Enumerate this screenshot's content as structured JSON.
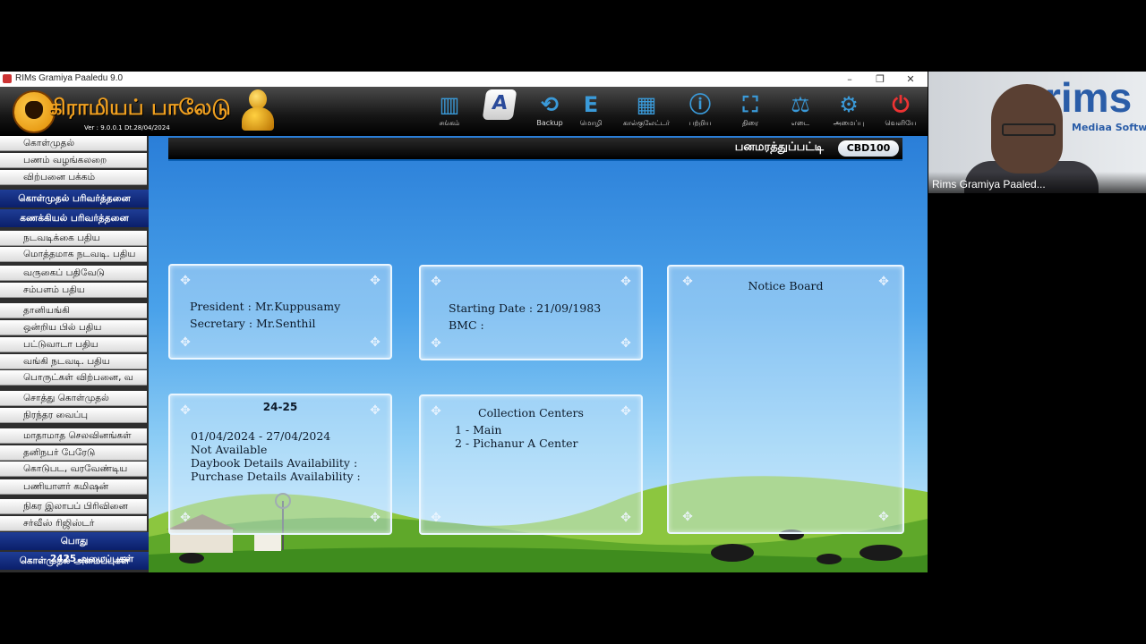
{
  "window": {
    "title": "RIMs Gramiya Paaledu 9.0",
    "minimize": "–",
    "restore": "❐",
    "close": "✕"
  },
  "header": {
    "logo_text": "கிராமியப் பாலேடு",
    "version": "Ver : 9.0.0.1     Dt.28/04/2024",
    "toolbar": [
      {
        "label": "சங்கம்",
        "icon": "building-icon",
        "glyph": "▥"
      },
      {
        "label": "",
        "icon": "keyboard-a-icon",
        "glyph": "A"
      },
      {
        "label": "Backup",
        "icon": "backup-icon",
        "glyph": "⟲"
      },
      {
        "label": "மொழி",
        "icon": "language-icon",
        "glyph": "E"
      },
      {
        "label": "கால்குலேட்டர்",
        "icon": "calculator-icon",
        "glyph": "▦"
      },
      {
        "label": "பற்றிய",
        "icon": "info-icon",
        "glyph": "ⓘ"
      },
      {
        "label": "திரை",
        "icon": "screen-icon",
        "glyph": "⛶"
      },
      {
        "label": "எடை",
        "icon": "weight-icon",
        "glyph": "⚖"
      },
      {
        "label": "அமைப்பு",
        "icon": "settings-icon",
        "glyph": "⚙"
      },
      {
        "label": "வெளியே",
        "icon": "power-icon",
        "glyph": "⏻"
      }
    ]
  },
  "sidebar": {
    "items": [
      {
        "label": "கொள்முதல்",
        "type": "item"
      },
      {
        "label": "பணம் வழங்கலறை",
        "type": "item"
      },
      {
        "label": "விற்பனை பக்கம்",
        "type": "item"
      },
      {
        "label": "கொள்முதல் பரிவர்த்தனை",
        "type": "head"
      },
      {
        "label": "கணக்கியல் பரிவர்த்தனை",
        "type": "head"
      },
      {
        "label": "நடவடிக்கை பதிய",
        "type": "item"
      },
      {
        "label": "மொத்தமாக நடவடி. பதிய",
        "type": "item"
      },
      {
        "label": "வருகைப் பதிவேடு",
        "type": "item"
      },
      {
        "label": "சம்பளம் பதிய",
        "type": "item"
      },
      {
        "label": "தானியங்கி",
        "type": "item"
      },
      {
        "label": "ஒன்றிய பில் பதிய",
        "type": "item"
      },
      {
        "label": "பட்டுவாடா பதிய",
        "type": "item"
      },
      {
        "label": "வங்கி நடவடி. பதிய",
        "type": "item"
      },
      {
        "label": "பொருட்கள் விற்பனை, வ",
        "type": "item"
      },
      {
        "label": "சொத்து கொள்முதல்",
        "type": "item"
      },
      {
        "label": "நிரந்தர வைப்பு",
        "type": "item"
      },
      {
        "label": "மாதாமாத செலவினங்கள்",
        "type": "item"
      },
      {
        "label": "தனிநபர் பேரேடு",
        "type": "item"
      },
      {
        "label": "கொடுபட, வரவேண்டிய",
        "type": "item"
      },
      {
        "label": "பணியாளர் கமிஷன்",
        "type": "item"
      },
      {
        "label": "நிகர இலாபப் பிரிவினை",
        "type": "item"
      },
      {
        "label": "சர்வீஸ் ரிஜிஸ்டர்",
        "type": "item"
      },
      {
        "label": "பொது",
        "type": "head"
      },
      {
        "label": "கொள்முதல் அமைப்புகள்",
        "type": "head"
      }
    ],
    "overlay_num": "2425",
    "overlay_text": "அமைப்புகள்"
  },
  "main": {
    "title": "பனமரத்துப்பட்டி",
    "code": "CBD100",
    "card1": {
      "president": "President : Mr.Kuppusamy",
      "secretary": "Secretary : Mr.Senthil"
    },
    "card2": {
      "starting": "Starting Date : 21/09/1983",
      "bmc": "BMC :"
    },
    "notice": {
      "title": "Notice Board"
    },
    "card4": {
      "year": "24-25",
      "range": "01/04/2024 - 27/04/2024",
      "status": "Not Available",
      "daybook": "Daybook Details Availability :",
      "purchase": "Purchase Details Availability :"
    },
    "card5": {
      "title": "Collection Centers",
      "c1": "1 - Main",
      "c2": "2 - Pichanur A Center"
    }
  },
  "video": {
    "brand": "rims",
    "brand_sub": "Mediaa Software",
    "name": "Rims Gramiya Paaled..."
  },
  "colors": {
    "accent": "#1f3d96",
    "main_blue": "#2a7ed8",
    "logo_orange": "#f0a020"
  }
}
